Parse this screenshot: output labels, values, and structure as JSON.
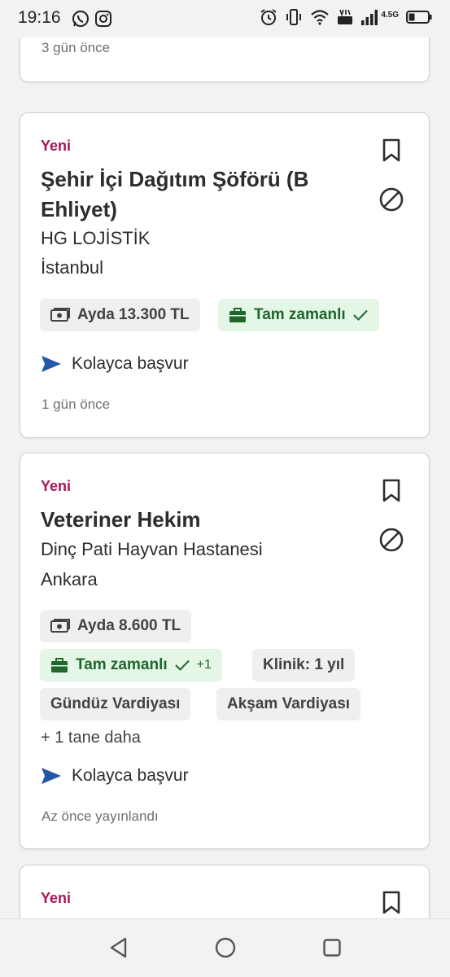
{
  "status_bar": {
    "time": "19:16",
    "network_label": "4.5G",
    "left_icons": [
      "whatsapp-icon",
      "instagram-icon"
    ],
    "right_icons": [
      "alarm-icon",
      "vibrate-icon",
      "wifi-icon",
      "volte-icon",
      "signal-icon",
      "battery-icon"
    ]
  },
  "jobs": [
    {
      "posted": "3 gün önce"
    },
    {
      "badge": "Yeni",
      "title": "Şehir İçi Dağıtım Şöförü (B Ehliyet)",
      "company": "HG LOJİSTİK",
      "location": "İstanbul",
      "salary": "Ayda 13.300 TL",
      "job_type": "Tam zamanlı",
      "apply": "Kolayca başvur",
      "posted": "1 gün önce"
    },
    {
      "badge": "Yeni",
      "title": "Veteriner Hekim",
      "company": "Dinç Pati Hayvan Hastanesi",
      "location": "Ankara",
      "salary": "Ayda 8.600 TL",
      "job_type": "Tam zamanlı",
      "job_type_extra": "+1",
      "tags": [
        "Klinik: 1 yıl",
        "Gündüz Vardiyası",
        "Akşam Vardiyası"
      ],
      "more": "+ 1 tane daha",
      "apply": "Kolayca başvur",
      "posted": "Az önce yayınlandı"
    },
    {
      "badge": "Yeni"
    }
  ],
  "colors": {
    "badge": "#a3195b",
    "apply_icon": "#2557a7",
    "green_chip_bg": "#e4f7e6",
    "green_chip_text": "#1f662c"
  }
}
